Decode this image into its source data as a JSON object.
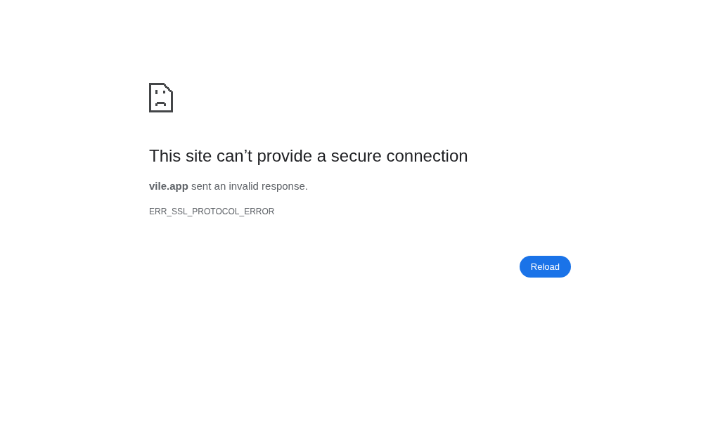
{
  "heading": "This site can’t provide a secure connection",
  "message": "**vile.app** sent an invalid response.",
  "error_code": "ERR_SSL_PROTOCOL_ERROR",
  "buttons": [
    {
      "label": "Reload"
    }
  ]
}
